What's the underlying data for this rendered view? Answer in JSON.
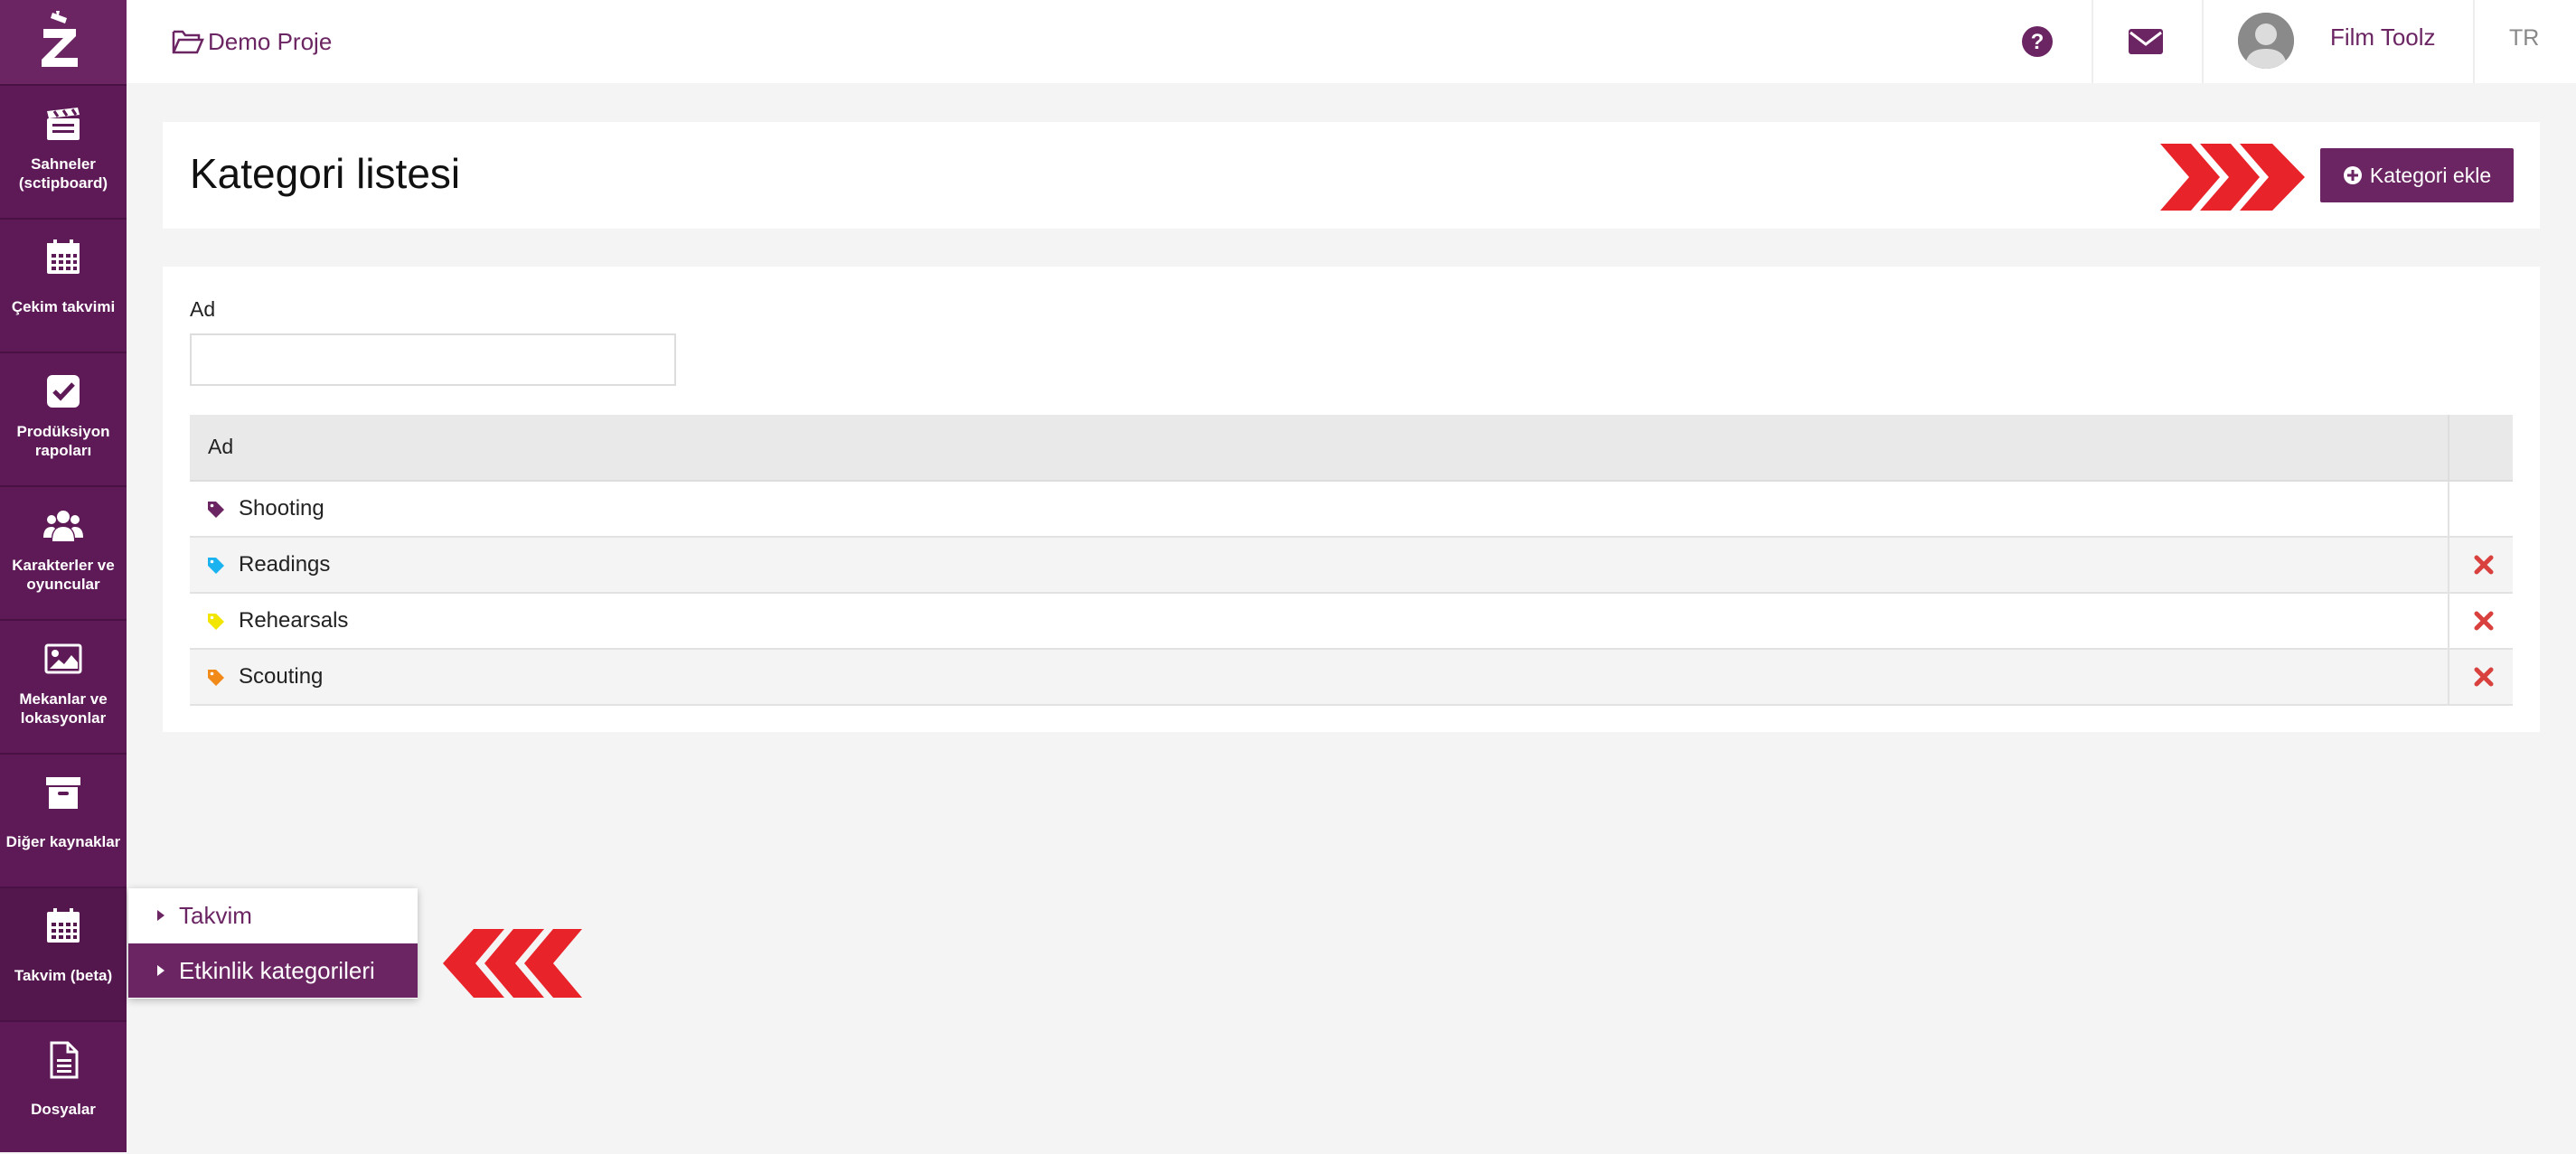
{
  "sidebar": {
    "logo": "Z",
    "items": [
      {
        "label": "Sahneler (sctipboard)",
        "icon": "clapperboard-icon"
      },
      {
        "label": "Çekim takvimi",
        "icon": "calendar-icon"
      },
      {
        "label": "Prodüksiyon rapoları",
        "icon": "checkbox-icon"
      },
      {
        "label": "Karakterler ve oyuncular",
        "icon": "users-icon"
      },
      {
        "label": "Mekanlar ve lokasyonlar",
        "icon": "image-icon"
      },
      {
        "label": "Diğer kaynaklar",
        "icon": "archive-icon"
      },
      {
        "label": "Takvim (beta)",
        "icon": "calendar-icon"
      },
      {
        "label": "Dosyalar",
        "icon": "file-icon"
      }
    ]
  },
  "topbar": {
    "project": "Demo Proje",
    "user": "Film Toolz",
    "language": "TR"
  },
  "header": {
    "title": "Kategori listesi",
    "add_button": "Kategori ekle"
  },
  "filter": {
    "label": "Ad",
    "value": ""
  },
  "table": {
    "column": "Ad",
    "rows": [
      {
        "name": "Shooting",
        "color": "#6b2563",
        "deletable": false
      },
      {
        "name": "Readings",
        "color": "#1ab3f0",
        "deletable": true
      },
      {
        "name": "Rehearsals",
        "color": "#f2e600",
        "deletable": true
      },
      {
        "name": "Scouting",
        "color": "#f28a1a",
        "deletable": true
      }
    ]
  },
  "submenu": {
    "items": [
      {
        "label": "Takvim",
        "active": false
      },
      {
        "label": "Etkinlik kategorileri",
        "active": true
      }
    ]
  },
  "colors": {
    "brand": "#6b2563",
    "sidebar": "#5e1a57",
    "danger": "#d9413f",
    "annotation": "#e8232a"
  }
}
